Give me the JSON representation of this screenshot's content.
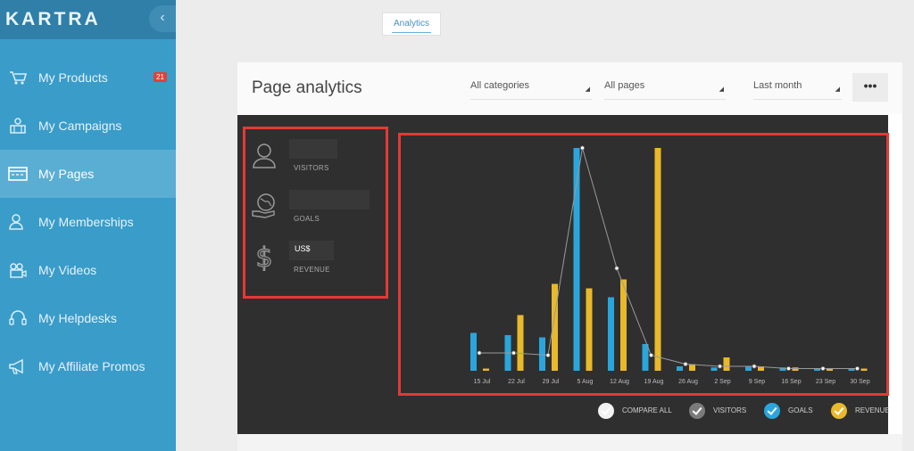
{
  "sidebar": {
    "logo": "KARTRA",
    "collapse_icon": "chevron-left-icon",
    "items": [
      {
        "label": "My Products",
        "icon": "cart-icon",
        "badge": "21"
      },
      {
        "label": "My Campaigns",
        "icon": "campaign-icon"
      },
      {
        "label": "My Pages",
        "icon": "pages-icon",
        "active": true
      },
      {
        "label": "My Memberships",
        "icon": "membership-icon"
      },
      {
        "label": "My Videos",
        "icon": "video-icon"
      },
      {
        "label": "My Helpdesks",
        "icon": "headset-icon"
      },
      {
        "label": "My Affiliate Promos",
        "icon": "megaphone-icon"
      }
    ]
  },
  "tabs": {
    "analytics": "Analytics"
  },
  "panel": {
    "title": "Page analytics",
    "filters": {
      "category": "All categories",
      "pages": "All pages",
      "period": "Last month"
    },
    "more_label": "•••"
  },
  "metrics": {
    "visitors": {
      "label": "VISITORS",
      "value": ""
    },
    "goals": {
      "label": "GOALS",
      "value": ""
    },
    "revenue": {
      "label": "REVENUE",
      "value": "US$"
    }
  },
  "legend": {
    "compare_all": "COMPARE ALL",
    "visitors": "VISITORS",
    "goals": "GOALS",
    "revenue": "REVENUE"
  },
  "colors": {
    "goals": "#2aa6dc",
    "revenue": "#e8b92a",
    "visitors_line": "#9a9a9a",
    "visitors_dot": "#7b7b7b"
  },
  "chart_data": {
    "type": "bar",
    "categories": [
      "15 Jul",
      "22 Jul",
      "29 Jul",
      "5 Aug",
      "12 Aug",
      "19 Aug",
      "26 Aug",
      "2 Sep",
      "9 Sep",
      "16 Sep",
      "23 Sep",
      "30 Sep"
    ],
    "series": [
      {
        "name": "GOALS",
        "values": [
          17,
          16,
          15,
          100,
          33,
          12,
          2,
          1.5,
          2,
          1.5,
          1,
          1
        ]
      },
      {
        "name": "REVENUE",
        "values": [
          1,
          25,
          39,
          37,
          41,
          100,
          3,
          6,
          2,
          1.5,
          1,
          1
        ]
      },
      {
        "name": "VISITORS",
        "type": "line",
        "values": [
          8,
          8,
          7,
          100,
          46,
          7,
          3,
          2,
          2,
          1,
          1,
          1
        ]
      }
    ],
    "ylim": [
      0,
      100
    ],
    "grid": false,
    "legend": "bottom-right"
  }
}
